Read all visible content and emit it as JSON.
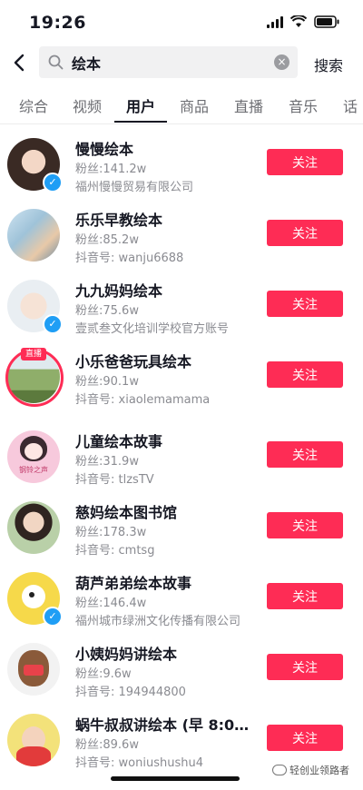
{
  "status_bar": {
    "time": "19:26"
  },
  "search": {
    "query": "绘本",
    "button_label": "搜索"
  },
  "tabs": [
    {
      "label": "综合",
      "active": false
    },
    {
      "label": "视频",
      "active": false
    },
    {
      "label": "用户",
      "active": true
    },
    {
      "label": "商品",
      "active": false
    },
    {
      "label": "直播",
      "active": false
    },
    {
      "label": "音乐",
      "active": false
    },
    {
      "label": "话",
      "active": false
    }
  ],
  "users": [
    {
      "name": "慢慢绘本",
      "fans": "粉丝:141.2w",
      "detail": "福州慢慢贸易有限公司",
      "verified": true,
      "live": false,
      "follow_label": "关注"
    },
    {
      "name": "乐乐早教绘本",
      "fans": "粉丝:85.2w",
      "detail": "抖音号: wanju6688",
      "verified": false,
      "live": false,
      "follow_label": "关注"
    },
    {
      "name": "九九妈妈绘本",
      "fans": "粉丝:75.6w",
      "detail": "壹贰叁文化培训学校官方账号",
      "verified": true,
      "live": false,
      "follow_label": "关注"
    },
    {
      "name": "小乐爸爸玩具绘本",
      "fans": "粉丝:90.1w",
      "detail": "抖音号: xiaolemamama",
      "verified": false,
      "live": true,
      "live_label": "直播",
      "follow_label": "关注"
    },
    {
      "name": "儿童绘本故事",
      "fans": "粉丝:31.9w",
      "detail": "抖音号: tlzsTV",
      "verified": false,
      "live": false,
      "avatar_text": "钢铃之声",
      "follow_label": "关注"
    },
    {
      "name": "慈妈绘本图书馆",
      "fans": "粉丝:178.3w",
      "detail": "抖音号: cmtsg",
      "verified": false,
      "live": false,
      "follow_label": "关注"
    },
    {
      "name": "葫芦弟弟绘本故事",
      "fans": "粉丝:146.4w",
      "detail": "福州城市绿洲文化传播有限公司",
      "verified": true,
      "live": false,
      "follow_label": "关注"
    },
    {
      "name": "小姨妈妈讲绘本",
      "fans": "粉丝:9.6w",
      "detail": "抖音号: 194944800",
      "verified": false,
      "live": false,
      "follow_label": "关注"
    },
    {
      "name": "蜗牛叔叔讲绘本 (早 8:00 ...",
      "fans": "粉丝:89.6w",
      "detail": "抖音号: woniushushu4",
      "verified": false,
      "live": false,
      "follow_label": "关注"
    }
  ],
  "watermark": "轻创业领路者",
  "colors": {
    "accent": "#fe2c55",
    "verified": "#1f9ef5"
  }
}
